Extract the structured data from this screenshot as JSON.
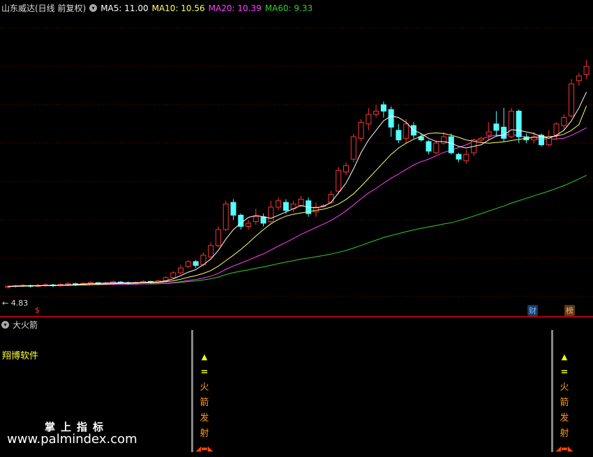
{
  "header": {
    "stock": "山东威达(日线 前复权)",
    "ma": [
      {
        "label": "MA5: 11.00",
        "color": "#ffffff"
      },
      {
        "label": "MA10: 10.56",
        "color": "#ffff66"
      },
      {
        "label": "MA20: 10.39",
        "color": "#ff40ff"
      },
      {
        "label": "MA60: 9.33",
        "color": "#33cc33"
      }
    ]
  },
  "price_low_label": "4.83",
  "badges": {
    "cai": "财",
    "bang": "榜"
  },
  "indicator": {
    "title": "大火箭",
    "watermark_text": "翔博软件",
    "brand_cn": "掌上指标",
    "brand_url": "www.palmindex.com",
    "signal_chars": [
      "火",
      "箭",
      "发",
      "射"
    ]
  },
  "colors": {
    "up": "#ff3333",
    "down": "#55ffff",
    "grid": "#8b0000",
    "bg": "#000000"
  },
  "chart_data": {
    "type": "candlestick",
    "ylim": [
      4.5,
      13.0
    ],
    "candles": [
      [
        4.9,
        4.93,
        4.85,
        4.95
      ],
      [
        4.92,
        4.95,
        4.88,
        4.98
      ],
      [
        4.94,
        4.96,
        4.9,
        5.0
      ],
      [
        4.95,
        4.93,
        4.88,
        4.98
      ],
      [
        4.93,
        4.96,
        4.9,
        5.0
      ],
      [
        4.96,
        4.98,
        4.92,
        5.02
      ],
      [
        4.97,
        4.95,
        4.9,
        5.0
      ],
      [
        4.95,
        4.99,
        4.92,
        5.03
      ],
      [
        4.99,
        5.02,
        4.95,
        5.05
      ],
      [
        5.01,
        4.98,
        4.94,
        5.04
      ],
      [
        4.98,
        5.02,
        4.96,
        5.06
      ],
      [
        5.02,
        5.05,
        4.98,
        5.08
      ],
      [
        5.04,
        5.01,
        4.97,
        5.06
      ],
      [
        5.01,
        5.03,
        4.98,
        5.07
      ],
      [
        5.03,
        5.07,
        5.0,
        5.1
      ],
      [
        5.06,
        5.04,
        5.0,
        5.09
      ],
      [
        5.04,
        5.02,
        4.98,
        5.08
      ],
      [
        5.02,
        5.05,
        4.99,
        5.08
      ],
      [
        5.05,
        5.08,
        5.02,
        5.12
      ],
      [
        5.08,
        5.06,
        5.02,
        5.1
      ],
      [
        5.06,
        5.1,
        5.03,
        5.13
      ],
      [
        5.1,
        5.2,
        5.06,
        5.24
      ],
      [
        5.2,
        5.35,
        5.15,
        5.4
      ],
      [
        5.35,
        5.5,
        5.3,
        5.6
      ],
      [
        5.55,
        5.7,
        5.5,
        5.75
      ],
      [
        5.7,
        5.58,
        5.5,
        5.75
      ],
      [
        5.6,
        5.9,
        5.55,
        5.98
      ],
      [
        5.85,
        6.2,
        5.8,
        6.3
      ],
      [
        6.2,
        6.7,
        6.15,
        6.8
      ],
      [
        6.7,
        7.5,
        6.65,
        7.6
      ],
      [
        7.55,
        7.15,
        7.0,
        7.65
      ],
      [
        7.15,
        6.8,
        6.7,
        7.2
      ],
      [
        6.8,
        6.9,
        6.7,
        7.0
      ],
      [
        6.95,
        7.1,
        6.85,
        7.35
      ],
      [
        7.1,
        6.9,
        6.8,
        7.2
      ],
      [
        6.95,
        7.4,
        6.9,
        7.6
      ],
      [
        7.4,
        7.6,
        7.3,
        7.7
      ],
      [
        7.55,
        7.3,
        7.2,
        7.65
      ],
      [
        7.35,
        7.5,
        7.25,
        7.6
      ],
      [
        7.45,
        7.65,
        7.4,
        7.75
      ],
      [
        7.6,
        7.2,
        7.1,
        7.7
      ],
      [
        7.25,
        7.4,
        7.1,
        7.55
      ],
      [
        7.45,
        7.45,
        7.4,
        7.5
      ],
      [
        7.55,
        7.8,
        7.5,
        7.9
      ],
      [
        7.9,
        8.55,
        7.8,
        8.65
      ],
      [
        8.5,
        8.7,
        8.4,
        8.8
      ],
      [
        8.9,
        9.6,
        8.8,
        9.7
      ],
      [
        9.55,
        10.05,
        9.45,
        10.15
      ],
      [
        10.0,
        10.3,
        9.8,
        10.5
      ],
      [
        10.3,
        10.4,
        10.2,
        10.6
      ],
      [
        10.6,
        10.4,
        10.2,
        10.7
      ],
      [
        10.45,
        9.9,
        9.6,
        10.55
      ],
      [
        9.8,
        9.5,
        9.4,
        10.0
      ],
      [
        9.55,
        10.0,
        9.4,
        10.15
      ],
      [
        9.95,
        9.65,
        9.55,
        10.05
      ],
      [
        9.6,
        9.5,
        9.45,
        9.7
      ],
      [
        9.45,
        9.15,
        9.05,
        9.5
      ],
      [
        9.1,
        9.4,
        9.05,
        9.5
      ],
      [
        9.4,
        9.6,
        9.35,
        9.75
      ],
      [
        9.6,
        9.1,
        9.05,
        9.7
      ],
      [
        9.05,
        8.9,
        8.8,
        9.1
      ],
      [
        8.85,
        9.05,
        8.75,
        9.2
      ],
      [
        9.1,
        9.5,
        9.0,
        9.55
      ],
      [
        9.5,
        9.55,
        9.4,
        9.6
      ],
      [
        9.65,
        9.75,
        9.5,
        10.05
      ],
      [
        10.0,
        9.8,
        9.6,
        10.4
      ],
      [
        9.9,
        9.55,
        9.45,
        10.5
      ],
      [
        9.6,
        10.4,
        9.55,
        10.5
      ],
      [
        10.4,
        9.6,
        9.4,
        10.45
      ],
      [
        9.6,
        9.5,
        9.4,
        9.7
      ],
      [
        9.5,
        9.6,
        9.4,
        9.75
      ],
      [
        9.65,
        9.35,
        9.3,
        9.7
      ],
      [
        9.35,
        9.6,
        9.3,
        9.8
      ],
      [
        9.65,
        10.0,
        9.5,
        10.05
      ],
      [
        9.95,
        10.2,
        9.8,
        10.3
      ],
      [
        10.25,
        11.25,
        10.2,
        11.4
      ],
      [
        11.35,
        11.5,
        11.2,
        11.6
      ],
      [
        11.55,
        11.8,
        11.4,
        12.0
      ]
    ],
    "ma_values": {
      "MA5": [
        4.92,
        4.93,
        4.94,
        4.95,
        4.95,
        4.95,
        4.96,
        4.96,
        4.97,
        4.98,
        5.0,
        5.01,
        5.02,
        5.03,
        5.04,
        5.04,
        5.04,
        5.04,
        5.05,
        5.06,
        5.06,
        5.1,
        5.16,
        5.26,
        5.37,
        5.45,
        5.6,
        5.78,
        6.05,
        6.4,
        6.7,
        6.9,
        7.08,
        7.14,
        7.1,
        7.05,
        7.15,
        7.25,
        7.35,
        7.45,
        7.4,
        7.38,
        7.42,
        7.55,
        7.85,
        8.15,
        8.6,
        9.1,
        9.5,
        9.8,
        10.1,
        10.25,
        10.2,
        10.05,
        9.8,
        9.7,
        9.55,
        9.45,
        9.45,
        9.4,
        9.3,
        9.25,
        9.3,
        9.35,
        9.5,
        9.62,
        9.65,
        9.82,
        9.8,
        9.75,
        9.7,
        9.6,
        9.55,
        9.65,
        9.8,
        10.1,
        10.5,
        11.0
      ],
      "MA10": [
        4.92,
        4.93,
        4.93,
        4.94,
        4.94,
        4.95,
        4.95,
        4.96,
        4.96,
        4.97,
        4.97,
        4.98,
        4.99,
        5.0,
        5.01,
        5.02,
        5.02,
        5.03,
        5.04,
        5.04,
        5.05,
        5.07,
        5.1,
        5.15,
        5.21,
        5.26,
        5.33,
        5.42,
        5.56,
        5.73,
        5.9,
        6.08,
        6.28,
        6.5,
        6.7,
        6.88,
        7.02,
        7.12,
        7.18,
        7.22,
        7.26,
        7.3,
        7.34,
        7.4,
        7.5,
        7.64,
        7.82,
        8.05,
        8.3,
        8.55,
        8.8,
        9.05,
        9.25,
        9.4,
        9.52,
        9.62,
        9.7,
        9.72,
        9.7,
        9.65,
        9.58,
        9.5,
        9.46,
        9.42,
        9.4,
        9.42,
        9.44,
        9.48,
        9.52,
        9.55,
        9.58,
        9.6,
        9.6,
        9.62,
        9.68,
        9.8,
        9.98,
        10.56
      ]
    }
  }
}
